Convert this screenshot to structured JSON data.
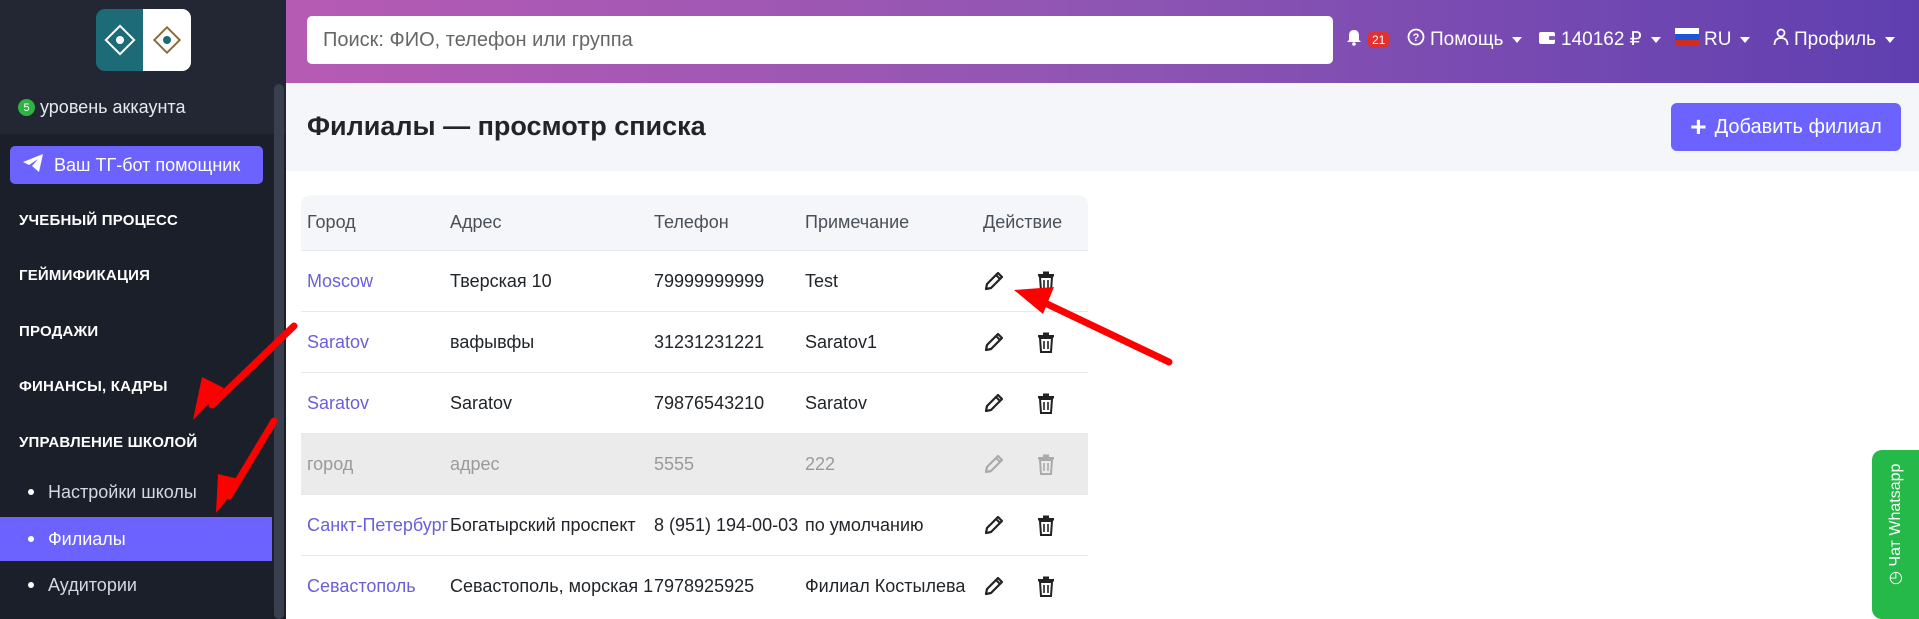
{
  "sidebar": {
    "account_level_badge": "5",
    "account_level_text": "уровень аккаунта",
    "tg_button_label": "Ваш ТГ-бот помощник",
    "sections": [
      "УЧЕБНЫЙ ПРОЦЕСС",
      "ГЕЙМИФИКАЦИЯ",
      "ПРОДАЖИ",
      "ФИНАНСЫ, КАДРЫ",
      "УПРАВЛЕНИЕ ШКОЛОЙ"
    ],
    "submenu": [
      "Настройки школы",
      "Филиалы",
      "Аудитории"
    ],
    "active_submenu": "Филиалы"
  },
  "topbar": {
    "search_placeholder": "Поиск: ФИО, телефон или группа",
    "notifications_count": "21",
    "help_label": "Помощь",
    "balance": "140162 ₽",
    "language": "RU",
    "profile_label": "Профиль"
  },
  "page": {
    "title": "Филиалы — просмотр списка",
    "add_button_label": "Добавить филиал"
  },
  "table": {
    "headers": [
      "Город",
      "Адрес",
      "Телефон",
      "Примечание",
      "Действие"
    ],
    "rows": [
      {
        "city": "Moscow",
        "address": "Тверская 10",
        "phone": "79999999999",
        "note": "Test",
        "disabled": false
      },
      {
        "city": "Saratov",
        "address": "вафывфы",
        "phone": "31231231221",
        "note": "Saratov1",
        "disabled": false
      },
      {
        "city": "Saratov",
        "address": "Saratov",
        "phone": "79876543210",
        "note": "Saratov",
        "disabled": false
      },
      {
        "city": "город",
        "address": "адрес",
        "phone": "5555",
        "note": "222",
        "disabled": true
      },
      {
        "city": "Санкт-Петербург",
        "address": "Богатырский проспект",
        "phone": "8 (951) 194-00-03",
        "note": "по умолчанию",
        "disabled": false
      },
      {
        "city": "Севастополь",
        "address": "Севастополь, морская 1",
        "phone": "7978925925",
        "note": "Филиал Костылева",
        "disabled": false
      }
    ]
  },
  "whatsapp_label": "Чат Whatsapp",
  "colors": {
    "accent": "#6c63ff",
    "sidebar": "#232733",
    "annotation_arrow": "#ff0000",
    "whatsapp": "#25b94a"
  }
}
